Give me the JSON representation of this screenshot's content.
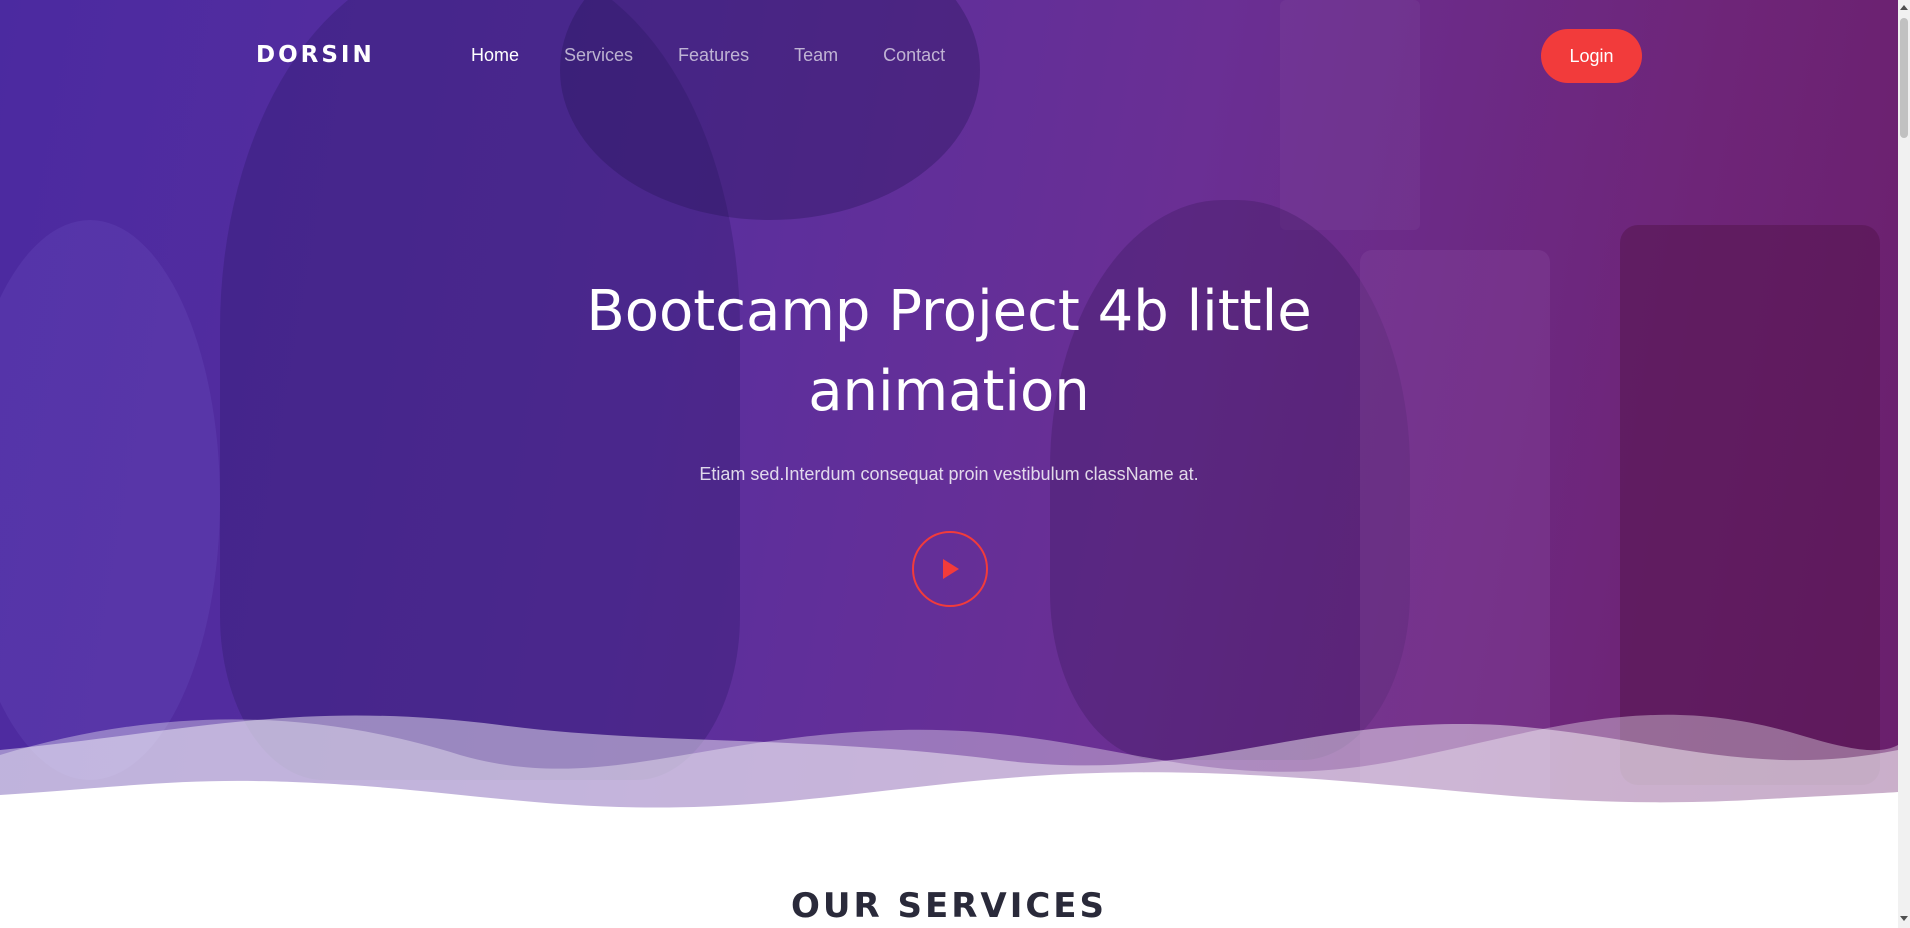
{
  "nav": {
    "logo": "DORSIN",
    "items": [
      {
        "label": "Home",
        "active": true
      },
      {
        "label": "Services",
        "active": false
      },
      {
        "label": "Features",
        "active": false
      },
      {
        "label": "Team",
        "active": false
      },
      {
        "label": "Contact",
        "active": false
      }
    ],
    "login_label": "Login"
  },
  "hero": {
    "title_line1": "Bootcamp Project 4b little",
    "title_line2": "animation",
    "subtitle": "Etiam sed.Interdum consequat proin vestibulum className at.",
    "play_icon": "play-icon"
  },
  "services": {
    "heading": "OUR SERVICES"
  },
  "colors": {
    "accent": "#f23b3b",
    "hero_start": "#4b2aa0",
    "hero_end": "#6a1f6c",
    "heading_text": "#2a2a3a"
  }
}
